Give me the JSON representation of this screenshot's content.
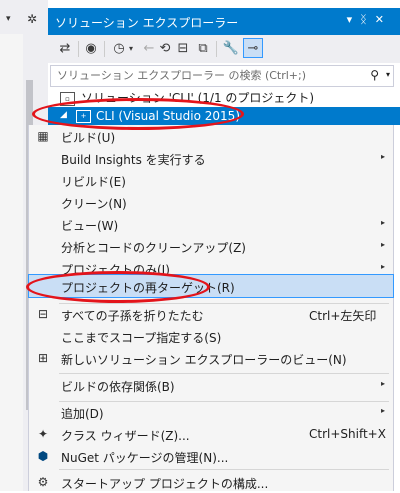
{
  "window": {
    "title": "ソリューション エクスプローラー",
    "title_icons": [
      "▾",
      "ᛝ",
      "✕"
    ]
  },
  "toolbar": {
    "icons": [
      "switch-views-icon",
      "globe-icon",
      "history-icon",
      "dropdown-icon",
      "back-icon",
      "sync-icon",
      "collapse-all-icon",
      "show-all-files-icon",
      "properties-wrench-icon",
      "preview-selected-icon"
    ]
  },
  "search": {
    "placeholder": "ソリューション エクスプローラー の検索 (Ctrl+;)"
  },
  "tree": {
    "solution_label": "ソリューション 'CLI' (1/1 のプロジェクト)",
    "project_label": "CLI (Visual Studio 2015)"
  },
  "menu": {
    "items": [
      {
        "label": "ビルド(U)",
        "icon": "build-icon"
      },
      {
        "label": "Build Insights を実行する",
        "submenu": "▸"
      },
      {
        "label": "リビルド(E)"
      },
      {
        "label": "クリーン(N)"
      },
      {
        "label": "ビュー(W)",
        "submenu": "▸"
      },
      {
        "label": "分析とコードのクリーンアップ(Z)",
        "submenu": "▸"
      },
      {
        "label": "プロジェクトのみ(J)",
        "submenu": "▸"
      },
      {
        "label": "プロジェクトの再ターゲット(R)"
      },
      {
        "label": "すべての子孫を折りたたむ",
        "shortcut": "Ctrl+左矢印",
        "icon": "collapse-icon"
      },
      {
        "label": "ここまでスコープ指定する(S)"
      },
      {
        "label": "新しいソリューション エクスプローラーのビュー(N)",
        "icon": "new-view-icon"
      },
      {
        "label": "ビルドの依存関係(B)",
        "submenu": "▸"
      },
      {
        "label": "追加(D)",
        "submenu": "▸"
      },
      {
        "label": "クラス ウィザード(Z)...",
        "shortcut": "Ctrl+Shift+X",
        "icon": "class-wizard-icon"
      },
      {
        "label": "NuGet パッケージの管理(N)...",
        "icon": "nuget-icon"
      },
      {
        "label": "スタートアップ プロジェクトの構成...",
        "icon": "gear-icon"
      }
    ]
  },
  "colors": {
    "accent": "#007acc",
    "highlight": "#c9def5",
    "annotation": "#e3141b"
  }
}
